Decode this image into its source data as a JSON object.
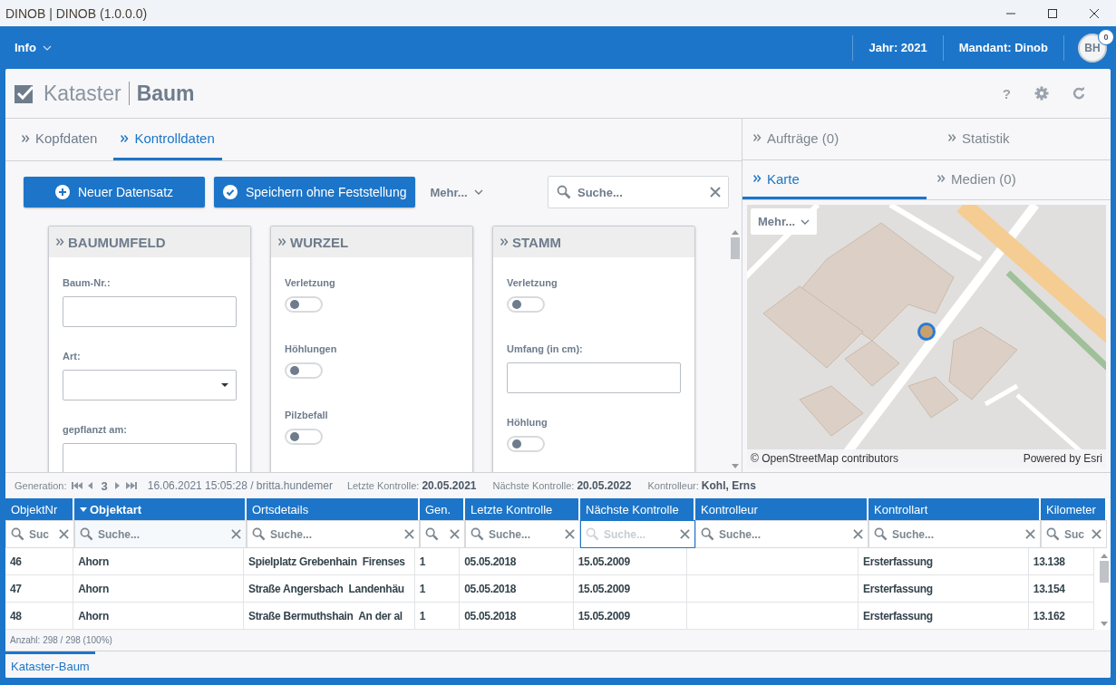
{
  "window": {
    "title": "DINOB | DINOB (1.0.0.0)"
  },
  "header": {
    "menu": "Info",
    "year": "Jahr: 2021",
    "client": "Mandant: Dinob",
    "avatar": "BH",
    "badge": "0"
  },
  "page": {
    "title": "Kataster",
    "subtitle": "Baum",
    "help": "?"
  },
  "left_tabs": [
    {
      "label": "Kopfdaten",
      "selected": false
    },
    {
      "label": "Kontrolldaten",
      "selected": true
    }
  ],
  "toolbar": {
    "buttons": [
      {
        "label": "Neuer Datensatz",
        "kind": "add"
      },
      {
        "label": "Speichern ohne Feststellung",
        "kind": "save"
      }
    ],
    "more": "Mehr...",
    "search": {
      "placeholder": "Suche..."
    }
  },
  "panels": [
    {
      "title": "BAUMUMFELD",
      "fields": [
        {
          "kind": "text",
          "label": "Baum-Nr.:"
        },
        {
          "kind": "select",
          "label": "Art:"
        },
        {
          "kind": "text",
          "label": "gepflanzt am:"
        }
      ]
    },
    {
      "title": "WURZEL",
      "fields": [
        {
          "kind": "toggle",
          "label": "Verletzung",
          "on": false
        },
        {
          "kind": "toggle",
          "label": "Höhlungen",
          "on": false
        },
        {
          "kind": "toggle",
          "label": "Pilzbefall",
          "on": false
        }
      ]
    },
    {
      "title": "STAMM",
      "fields": [
        {
          "kind": "toggle",
          "label": "Verletzung",
          "on": false
        },
        {
          "kind": "text",
          "label": "Umfang (in cm):"
        },
        {
          "kind": "toggle",
          "label": "Höhlung",
          "on": false
        }
      ]
    }
  ],
  "generation": {
    "label": "Generation:",
    "number": "3",
    "stamp": "16.06.2021 15:05:28 / britta.hundemer",
    "items": [
      {
        "label": "Letzte Kontrolle:",
        "value": "20.05.2021"
      },
      {
        "label": "Nächste Kontrolle:",
        "value": "20.05.2022"
      },
      {
        "label": "Kontrolleur:",
        "value": "Kohl, Erns"
      }
    ]
  },
  "table": {
    "columns": [
      {
        "label": "ObjektNr",
        "sorted": false,
        "filter": {
          "placeholder": "Suc",
          "focused": false
        }
      },
      {
        "label": "Objektart",
        "sorted": true,
        "filter": {
          "placeholder": "Suche...",
          "focused": false
        }
      },
      {
        "label": "Ortsdetails",
        "sorted": false,
        "filter": {
          "placeholder": "Suche...",
          "focused": false
        }
      },
      {
        "label": "Gen.",
        "sorted": false,
        "filter": {
          "focused": false
        }
      },
      {
        "label": "Letzte Kontrolle",
        "sorted": false,
        "filter": {
          "placeholder": "Suche...",
          "focused": false
        }
      },
      {
        "label": "Nächste Kontrolle",
        "sorted": false,
        "filter": {
          "placeholder": "Suche...",
          "focused": true
        }
      },
      {
        "label": "Kontrolleur",
        "sorted": false,
        "filter": {
          "placeholder": "Suche...",
          "focused": false
        }
      },
      {
        "label": "Kontrollart",
        "sorted": false,
        "filter": {
          "placeholder": "Suche...",
          "focused": false
        }
      },
      {
        "label": "Kilometer",
        "sorted": false,
        "filter": {
          "placeholder": "Suc",
          "focused": false
        }
      }
    ],
    "rows": [
      [
        "46",
        "Ahorn",
        "Spielplatz Grebenhain  Firenses",
        "1",
        "05.05.2018",
        "15.05.2009",
        "",
        "Ersterfassung",
        "13.138"
      ],
      [
        "47",
        "Ahorn",
        "Straße Angersbach  Landenhäu",
        "1",
        "05.05.2018",
        "15.05.2009",
        "",
        "Ersterfassung",
        "13.154"
      ],
      [
        "48",
        "Ahorn",
        "Straße Bermuthshain  An der al",
        "1",
        "05.05.2018",
        "15.05.2009",
        "",
        "Ersterfassung",
        "13.162"
      ]
    ],
    "count": "Anzahl: 298 / 298 (100%)"
  },
  "right_tabs": [
    [
      {
        "label": "Aufträge (0)",
        "selected": false
      },
      {
        "label": "Statistik",
        "selected": false
      }
    ],
    [
      {
        "label": "Karte",
        "selected": true
      },
      {
        "label": "Medien (0)",
        "selected": false
      }
    ]
  ],
  "map": {
    "kind": "picture",
    "more": "Mehr...",
    "attribution": "© OpenStreetMap contributors",
    "credit": "Powered by Esri"
  },
  "bottom_tabs": [
    {
      "label": "Kataster-Baum",
      "selected": true
    }
  ]
}
